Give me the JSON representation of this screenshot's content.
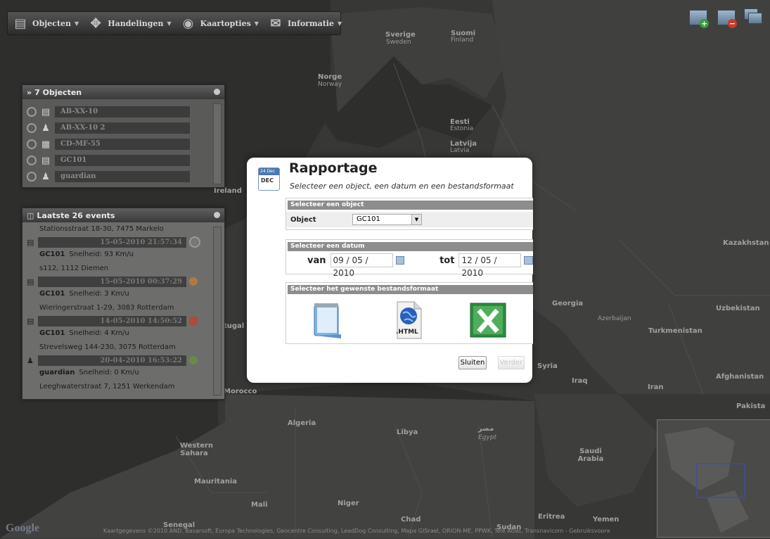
{
  "toolbar": {
    "items": [
      {
        "label": "Objecten",
        "icon": "car-icon"
      },
      {
        "label": "Handelingen",
        "icon": "actions-icon"
      },
      {
        "label": "Kaartopties",
        "icon": "globe-icon"
      },
      {
        "label": "Informatie",
        "icon": "info-icon"
      }
    ]
  },
  "map_labels": {
    "sverige": "Sverige",
    "sweden": "Sweden",
    "suomi": "Suomi",
    "finland": "Finland",
    "norge": "Norge",
    "norway": "Norway",
    "eesti": "Eesti",
    "estonia": "Estonia",
    "latvija": "Latvija",
    "latvia": "Latvia",
    "kazakhstan": "Kazakhstan",
    "uzbekistan": "Uzbekistan",
    "turkmenistan": "Turkmenistan",
    "afghanistan": "Afghanistan",
    "pakistan": "Pakista",
    "iran": "Iran",
    "iraq": "Iraq",
    "syria": "Syria",
    "georgia": "Georgia",
    "azerbaijan": "Azerbaijan",
    "algeria": "Algeria",
    "libya": "Libya",
    "egypt_ar": "مصر",
    "egypt": "Egypt",
    "western_sahara": "Western Sahara",
    "mauritania": "Mauritania",
    "mali": "Mali",
    "niger": "Niger",
    "chad": "Chad",
    "sudan": "Sudan",
    "senegal": "Senegal",
    "eritrea": "Eritrea",
    "yemen": "Yemen",
    "saudi": "Saudi Arabia",
    "morocco": "Morocco",
    "ireland": "Ireland",
    "portugal": "tugal",
    "attribution": "Kaartgegevens ©2010 AND, Basarsoft, Europa Technologies, Geocentre Consulting, LeadDog Consulting, Mapa GISrael, ORION-ME, PPWK, Tele Atlas, Transnavicom - Gebruiksvoorwaarden",
    "google": "Google"
  },
  "objects_panel": {
    "title": "7 Objecten",
    "items": [
      {
        "name": "AB-XX-10",
        "icon": "car-icon"
      },
      {
        "name": "AB-XX-10 2",
        "icon": "people-icon"
      },
      {
        "name": "CD-MF-55",
        "icon": "truck-icon"
      },
      {
        "name": "GC101",
        "icon": "car-icon"
      },
      {
        "name": "guardian",
        "icon": "person-icon"
      }
    ]
  },
  "events_panel": {
    "title": "Laatste 26 events",
    "first_address": "Stationsstraat 18-30, 7475 Markelo",
    "events": [
      {
        "datetime": "15-05-2010 21:57:34",
        "object": "GC101",
        "speed": "Snelheid: 93 Km/u",
        "address": "s112, 1112 Diemen",
        "status_color": "#8a8a8a",
        "icon": "car-icon"
      },
      {
        "datetime": "15-05-2010 00:37:29",
        "object": "GC101",
        "speed": "Snelheid: 3 Km/u",
        "address": "Wieringerstraat 1-29, 3083 Rotterdam",
        "status_color": "#b07a40",
        "icon": "car-icon"
      },
      {
        "datetime": "14-05-2010 14:50:52",
        "object": "GC101",
        "speed": "Snelheid: 4 Km/u",
        "address": "Strevelsweg 144-230, 3075 Rotterdam",
        "status_color": "#b04a3a",
        "icon": "car-icon"
      },
      {
        "datetime": "20-04-2010 16:53:22",
        "object": "guardian",
        "speed": "Snelheid: 0 Km/u",
        "address": "Leeghwaterstraat 7, 1251 Werkendam",
        "status_color": "#6a8a4a",
        "icon": "person-icon"
      }
    ]
  },
  "modal": {
    "icon_top": "24 Dec",
    "icon_day": "DEC",
    "title": "Rapportage",
    "subtitle": "Selecteer een object, een datum en een bestandsformaat",
    "section_object": {
      "heading": "Selecteer een object",
      "label": "Object",
      "selected": "GC101"
    },
    "section_date": {
      "heading": "Selecteer een datum",
      "from_label": "van",
      "from_value": "09 / 05 / 2010",
      "to_label": "tot",
      "to_value": "12 / 05 / 2010"
    },
    "section_format": {
      "heading": "Selecteer het gewenste bestandsformaat",
      "html_label": ".HTML"
    },
    "close_label": "Sluiten",
    "next_label": "Verder"
  },
  "colors": {
    "accent_blue": "#4a78b2",
    "excel_green": "#2e8a3e",
    "section_head": "#8d8d8d"
  }
}
